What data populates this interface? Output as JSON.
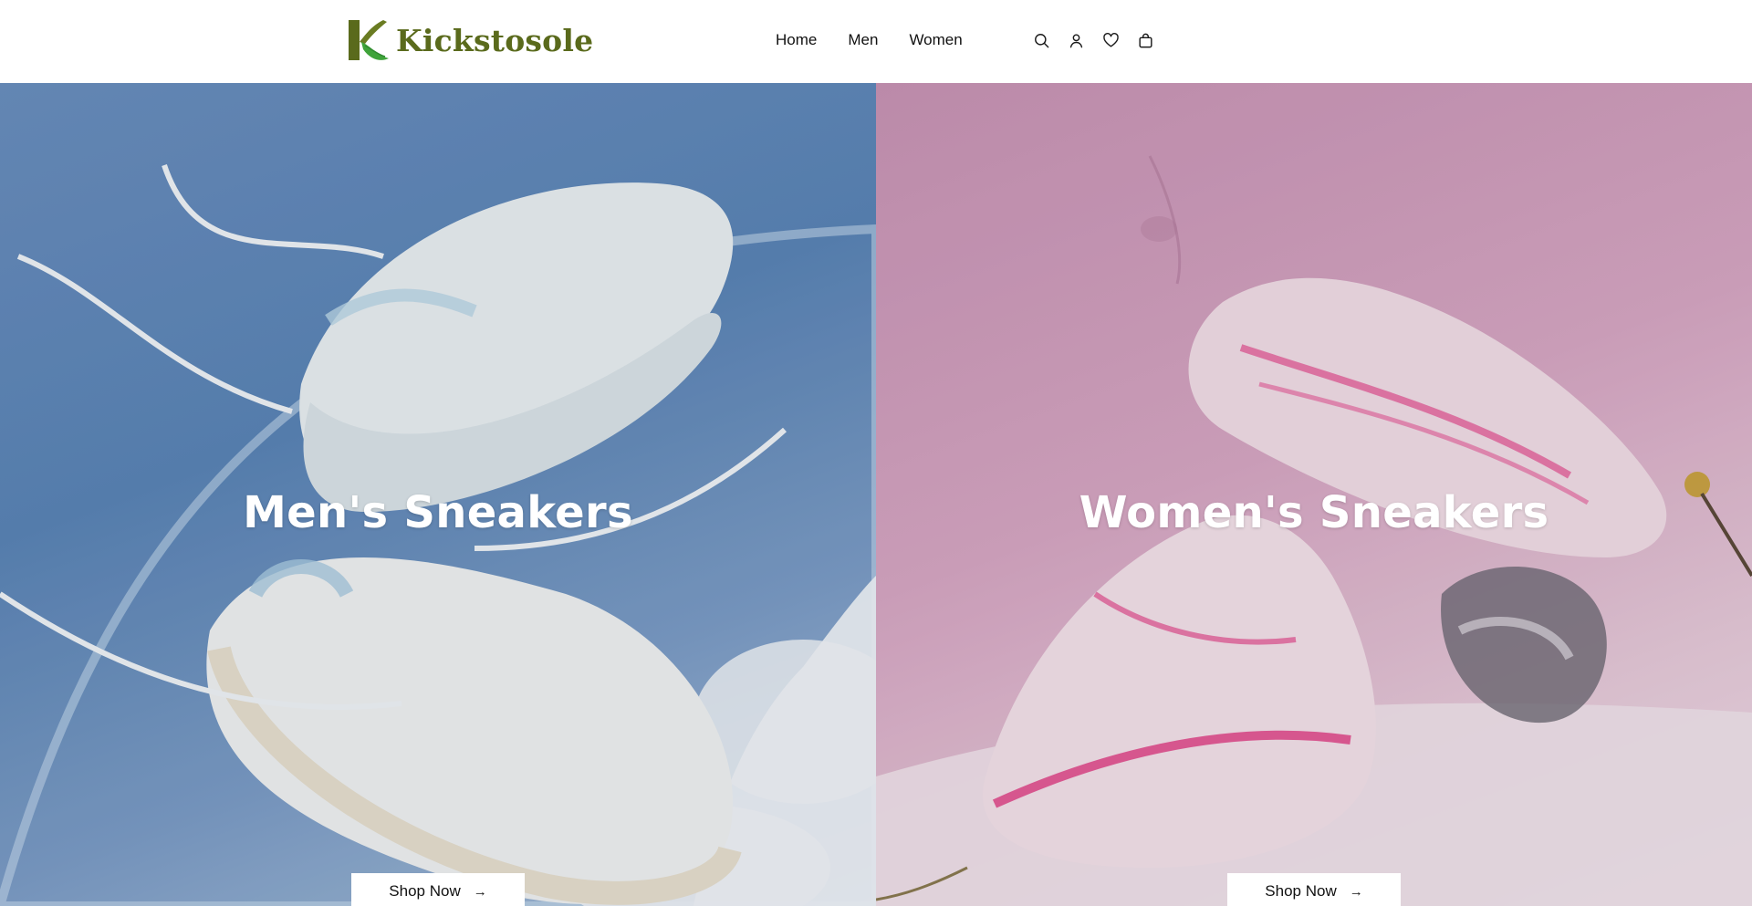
{
  "brand": {
    "name": "Kickstosole",
    "accent": "#5a6a1c",
    "mark_color": "#2f8a2e"
  },
  "nav": {
    "items": [
      {
        "label": "Home"
      },
      {
        "label": "Men"
      },
      {
        "label": "Women"
      }
    ]
  },
  "header_icons": [
    "search-icon",
    "account-icon",
    "wishlist-heart-icon",
    "cart-bag-icon"
  ],
  "hero": {
    "men": {
      "title": "Men's Sneakers",
      "cta": "Shop Now",
      "arrow": "→"
    },
    "women": {
      "title": "Women's Sneakers",
      "cta": "Shop Now",
      "arrow": "→"
    }
  }
}
